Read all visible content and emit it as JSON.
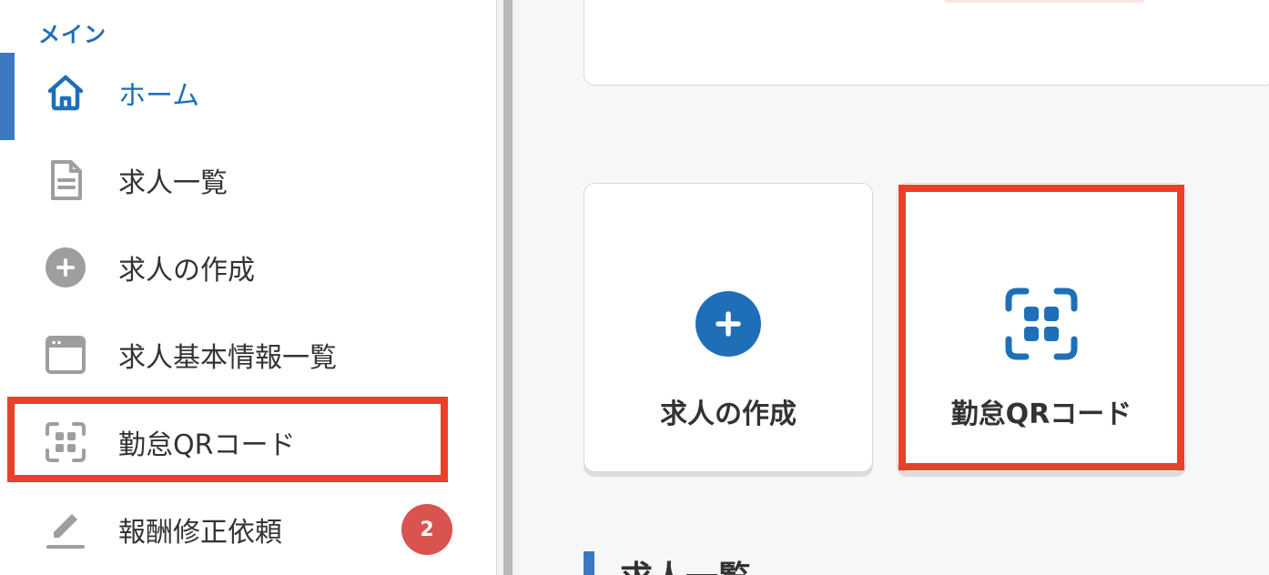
{
  "sidebar": {
    "section_label": "メイン",
    "items": [
      {
        "label": "ホーム",
        "icon": "home-icon",
        "active": true
      },
      {
        "label": "求人一覧",
        "icon": "document-icon"
      },
      {
        "label": "求人の作成",
        "icon": "plus-circle-icon"
      },
      {
        "label": "求人基本情報一覧",
        "icon": "window-icon"
      },
      {
        "label": "勤怠QRコード",
        "icon": "qr-scan-icon",
        "highlighted": true
      },
      {
        "label": "報酬修正依頼",
        "icon": "pencil-icon",
        "badge": "2"
      }
    ]
  },
  "main": {
    "tiles": [
      {
        "label": "求人の作成",
        "icon": "plus-circle-icon"
      },
      {
        "label": "勤怠QRコード",
        "icon": "qr-scan-icon",
        "highlighted": true
      }
    ],
    "section_heading": "求人一覧"
  },
  "colors": {
    "accent": "#1e6fb8",
    "active_indicator": "#3d78c2",
    "highlight": "#e8412a",
    "badge": "#d9534f",
    "icon_gray": "#9e9e9e"
  }
}
